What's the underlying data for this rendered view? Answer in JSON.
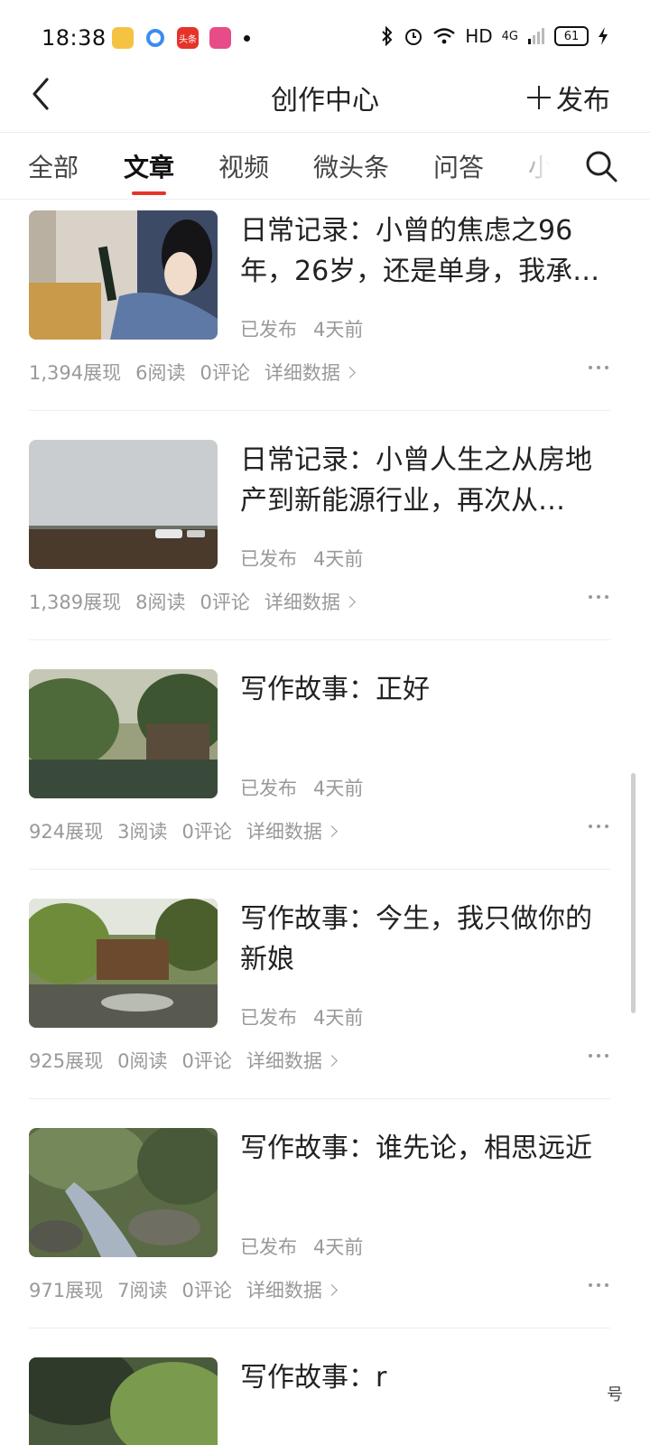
{
  "status_bar": {
    "time": "18:38",
    "app_icons": [
      {
        "name": "notes-app-icon",
        "color": "#f5c342"
      },
      {
        "name": "browser-app-icon",
        "color": "#3b8df0"
      },
      {
        "name": "toutiao-app-icon",
        "color": "#e6332a",
        "label": "头条"
      },
      {
        "name": "media-app-icon",
        "color": "#e84c88"
      }
    ],
    "network": "HD",
    "signal": "4G",
    "battery": "61"
  },
  "header": {
    "title": "创作中心",
    "publish_label": "发布"
  },
  "tabs": [
    "全部",
    "文章",
    "视频",
    "微头条",
    "问答",
    "小"
  ],
  "active_tab": "文章",
  "accent_color": "#e6332a",
  "articles": [
    {
      "title": "日常记录：小曾的焦虑之96年，26岁，还是单身，我承…",
      "status": "已发布",
      "time": "4天前",
      "impressions": "1,394展现",
      "reads": "6阅读",
      "comments": "0评论",
      "detail": "详细数据"
    },
    {
      "title": "日常记录：小曾人生之从房地产到新能源行业，再次从…",
      "status": "已发布",
      "time": "4天前",
      "impressions": "1,389展现",
      "reads": "8阅读",
      "comments": "0评论",
      "detail": "详细数据"
    },
    {
      "title": "写作故事：正好",
      "status": "已发布",
      "time": "4天前",
      "impressions": "924展现",
      "reads": "3阅读",
      "comments": "0评论",
      "detail": "详细数据"
    },
    {
      "title": "写作故事：今生，我只做你的新娘",
      "status": "已发布",
      "time": "4天前",
      "impressions": "925展现",
      "reads": "0阅读",
      "comments": "0评论",
      "detail": "详细数据"
    },
    {
      "title": "写作故事：谁先论，相思远近",
      "status": "已发布",
      "time": "4天前",
      "impressions": "971展现",
      "reads": "7阅读",
      "comments": "0评论",
      "detail": "详细数据"
    },
    {
      "title": "写作故事：r"
    }
  ],
  "watermark": "号"
}
